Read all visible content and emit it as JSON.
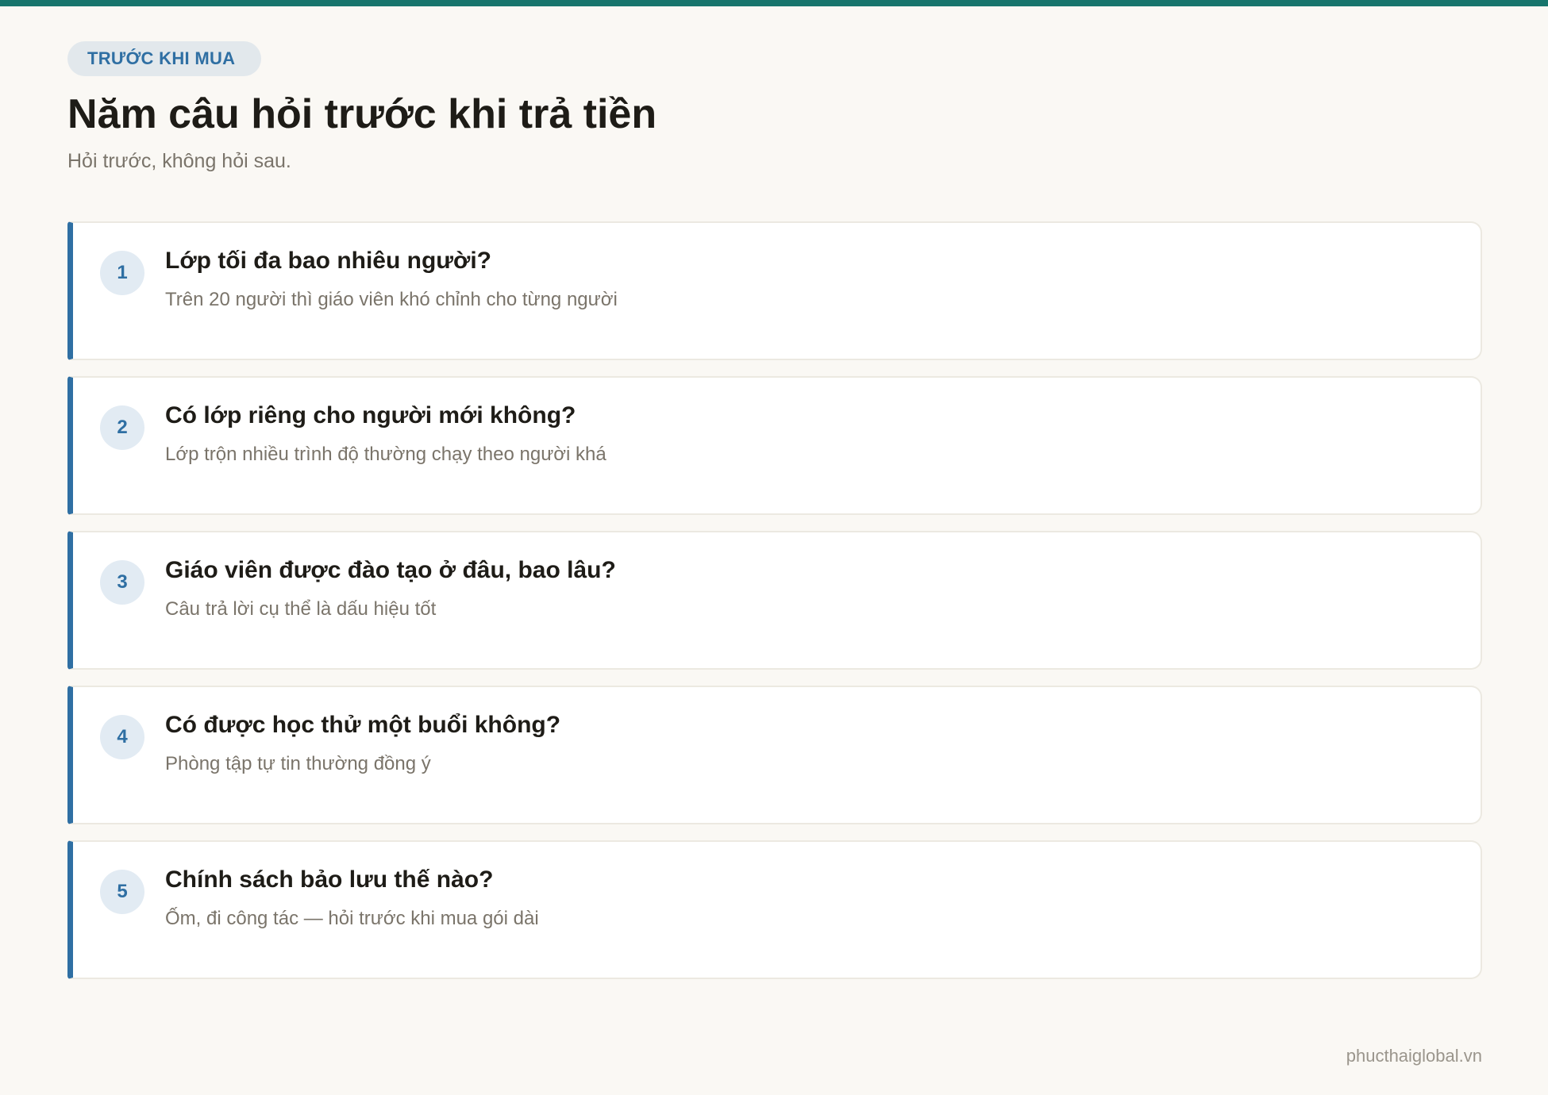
{
  "colors": {
    "top_bar": "#17756c",
    "accent": "#2f6fa3",
    "badge_bg": "#e2e8ec",
    "badge_text": "#2f6fa3",
    "background": "#faf8f4"
  },
  "header": {
    "badge": "TRƯỚC KHI MUA",
    "title": "Năm câu hỏi trước khi trả tiền",
    "subtitle": "Hỏi trước, không hỏi sau."
  },
  "questions": [
    {
      "number": "1",
      "question": "Lớp tối đa bao nhiêu người?",
      "answer": "Trên 20 người thì giáo viên khó chỉnh cho từng người"
    },
    {
      "number": "2",
      "question": "Có lớp riêng cho người mới không?",
      "answer": "Lớp trộn nhiều trình độ thường chạy theo người khá"
    },
    {
      "number": "3",
      "question": "Giáo viên được đào tạo ở đâu, bao lâu?",
      "answer": "Câu trả lời cụ thể là dấu hiệu tốt"
    },
    {
      "number": "4",
      "question": "Có được học thử một buổi không?",
      "answer": "Phòng tập tự tin thường đồng ý"
    },
    {
      "number": "5",
      "question": "Chính sách bảo lưu thế nào?",
      "answer": "Ốm, đi công tác — hỏi trước khi mua gói dài"
    }
  ],
  "footer": {
    "site": "phucthaiglobal.vn"
  }
}
